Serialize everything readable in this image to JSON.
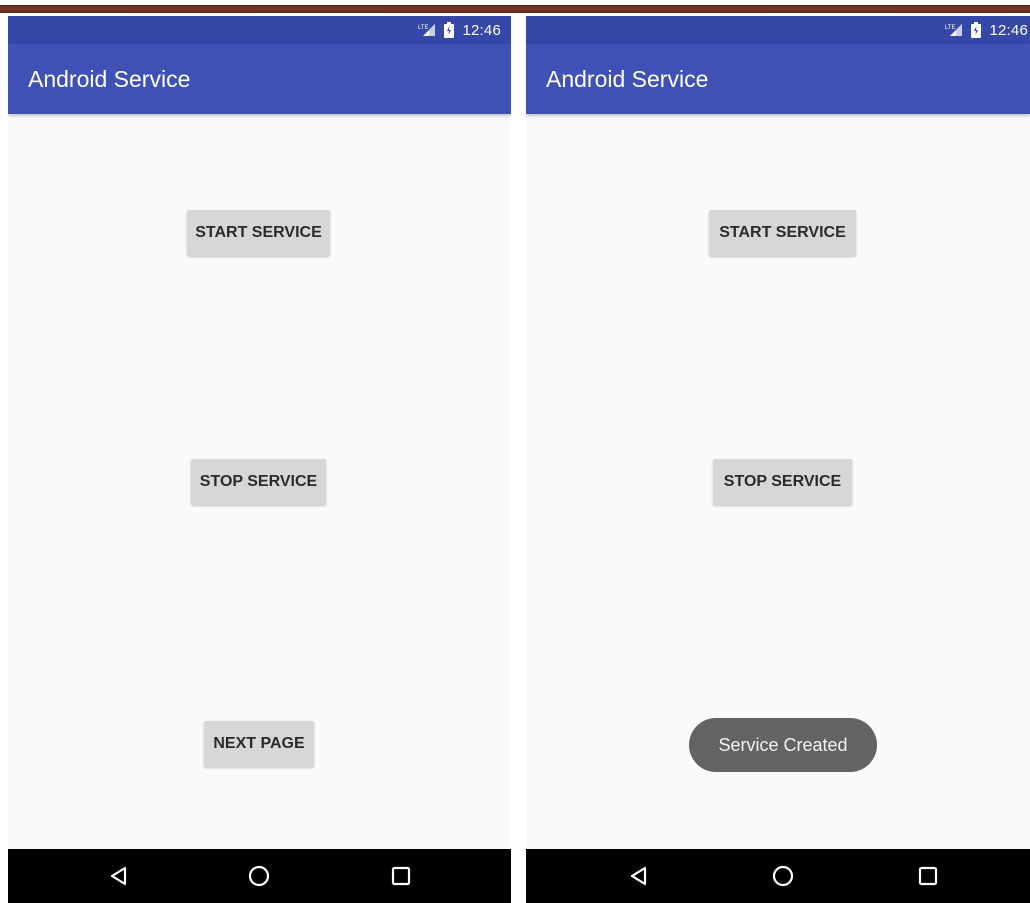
{
  "screens": {
    "left": {
      "status_time": "12:46",
      "app_title": "Android Service",
      "buttons": {
        "start": "START SERVICE",
        "stop": "STOP SERVICE",
        "next": "NEXT PAGE"
      }
    },
    "right": {
      "status_time": "12:46",
      "app_title": "Android Service",
      "buttons": {
        "start": "START SERVICE",
        "stop": "STOP SERVICE"
      },
      "toast": "Service Created"
    }
  },
  "colors": {
    "status_bar": "#3548a7",
    "app_bar": "#3f51b5",
    "button_bg": "#d6d7d7",
    "screen_bg": "#fafafa",
    "toast_bg": "#636363",
    "nav_bar": "#000000"
  },
  "icons": {
    "status": [
      "lte-signal-icon",
      "battery-icon"
    ],
    "nav": [
      "back-icon",
      "home-icon",
      "recents-icon"
    ]
  }
}
